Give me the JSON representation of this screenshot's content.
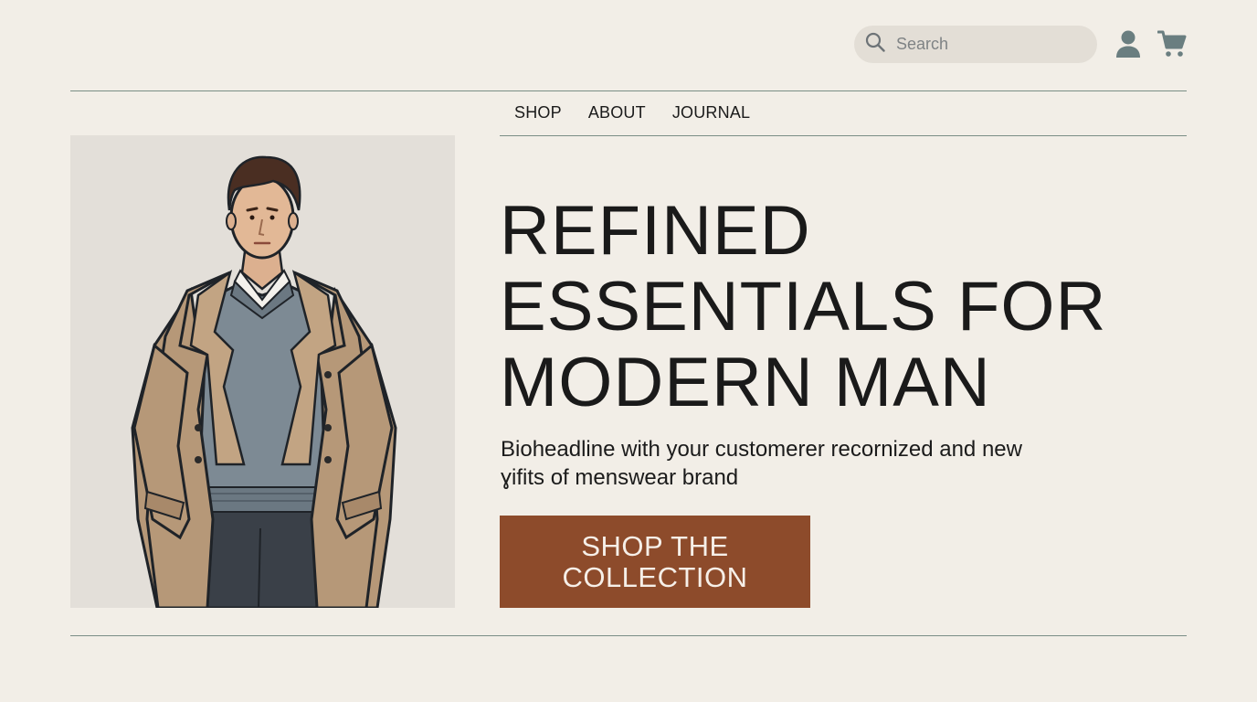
{
  "header": {
    "search": {
      "placeholder": "Search",
      "icon": "search-icon"
    },
    "account_icon": "user-icon",
    "cart_icon": "cart-icon"
  },
  "nav": {
    "items": [
      {
        "label": "SHOP"
      },
      {
        "label": "ABOUT"
      },
      {
        "label": "JOURNAL"
      }
    ]
  },
  "hero": {
    "headline_lines": [
      "REFINED",
      "ESSENTIALS FOR",
      "MODERN MAN"
    ],
    "subcopy": "Bioheadline with your customerer recornized and new ɣifits of menswear brand",
    "cta_label": "SHOP THE COLLECTION",
    "image": "illustration of man in trench coat"
  },
  "colors": {
    "background": "#f2eee7",
    "accent": "#8d4b2b",
    "rule": "#7a8e86",
    "icon": "#6a7e80"
  }
}
